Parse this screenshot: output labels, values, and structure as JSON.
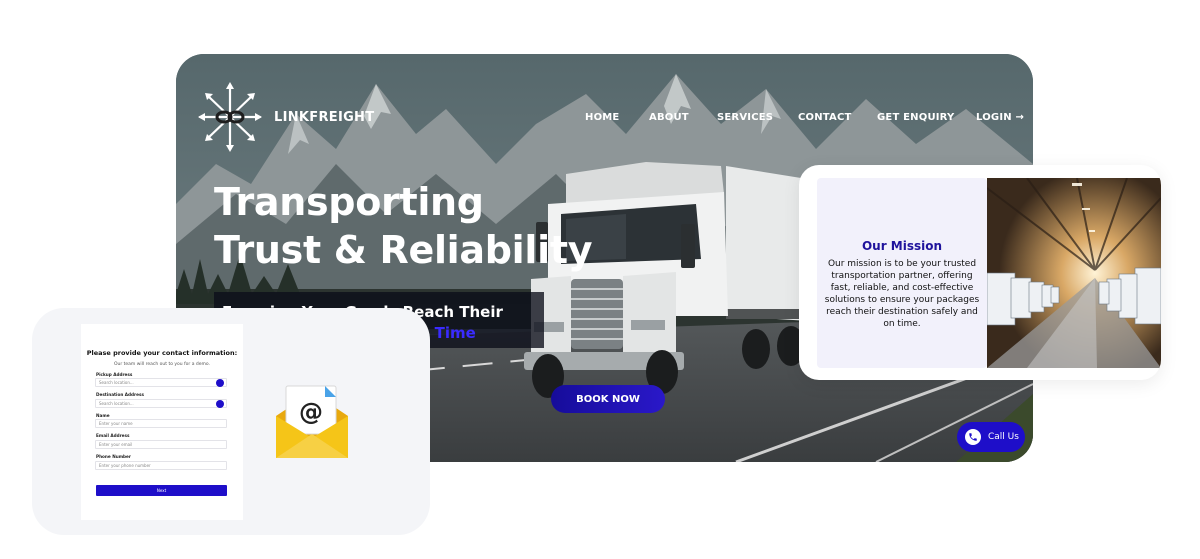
{
  "brand": {
    "name": "LINKFREIGHT"
  },
  "nav": {
    "items": [
      "HOME",
      "ABOUT",
      "SERVICES",
      "CONTACT",
      "GET ENQUIRY",
      "LOGIN →"
    ]
  },
  "hero": {
    "title_line1": "Transporting",
    "title_line2": "Trust & Reliability",
    "tagline_part1": "Ensuring Your Goods Reach Their",
    "tagline_part2": "On Time",
    "book_button": "BOOK NOW",
    "call_button": "Call Us"
  },
  "mission": {
    "title": "Our Mission",
    "body": "Our mission is to be your trusted transportation partner, offering fast, reliable, and cost-effective solutions to ensure your packages reach their destination safely and on time."
  },
  "contact_form": {
    "title": "Please provide your contact information:",
    "subtitle": "Our team will reach out to you for a demo.",
    "fields": [
      {
        "label": "Pickup Address",
        "placeholder": "Search location..."
      },
      {
        "label": "Destination Address",
        "placeholder": "Search location..."
      },
      {
        "label": "Name",
        "placeholder": "Enter your name"
      },
      {
        "label": "Email Address",
        "placeholder": "Enter your email"
      },
      {
        "label": "Phone Number",
        "placeholder": "Enter your phone number"
      }
    ],
    "submit": "Next"
  },
  "colors": {
    "accent": "#1e0ec9",
    "mission_title": "#1f139c",
    "mail_yellow": "#f5c518"
  },
  "icons": [
    "brand-network-icon",
    "location-pin-icon",
    "mail-envelope-icon",
    "phone-icon",
    "arrow-right-icon"
  ]
}
